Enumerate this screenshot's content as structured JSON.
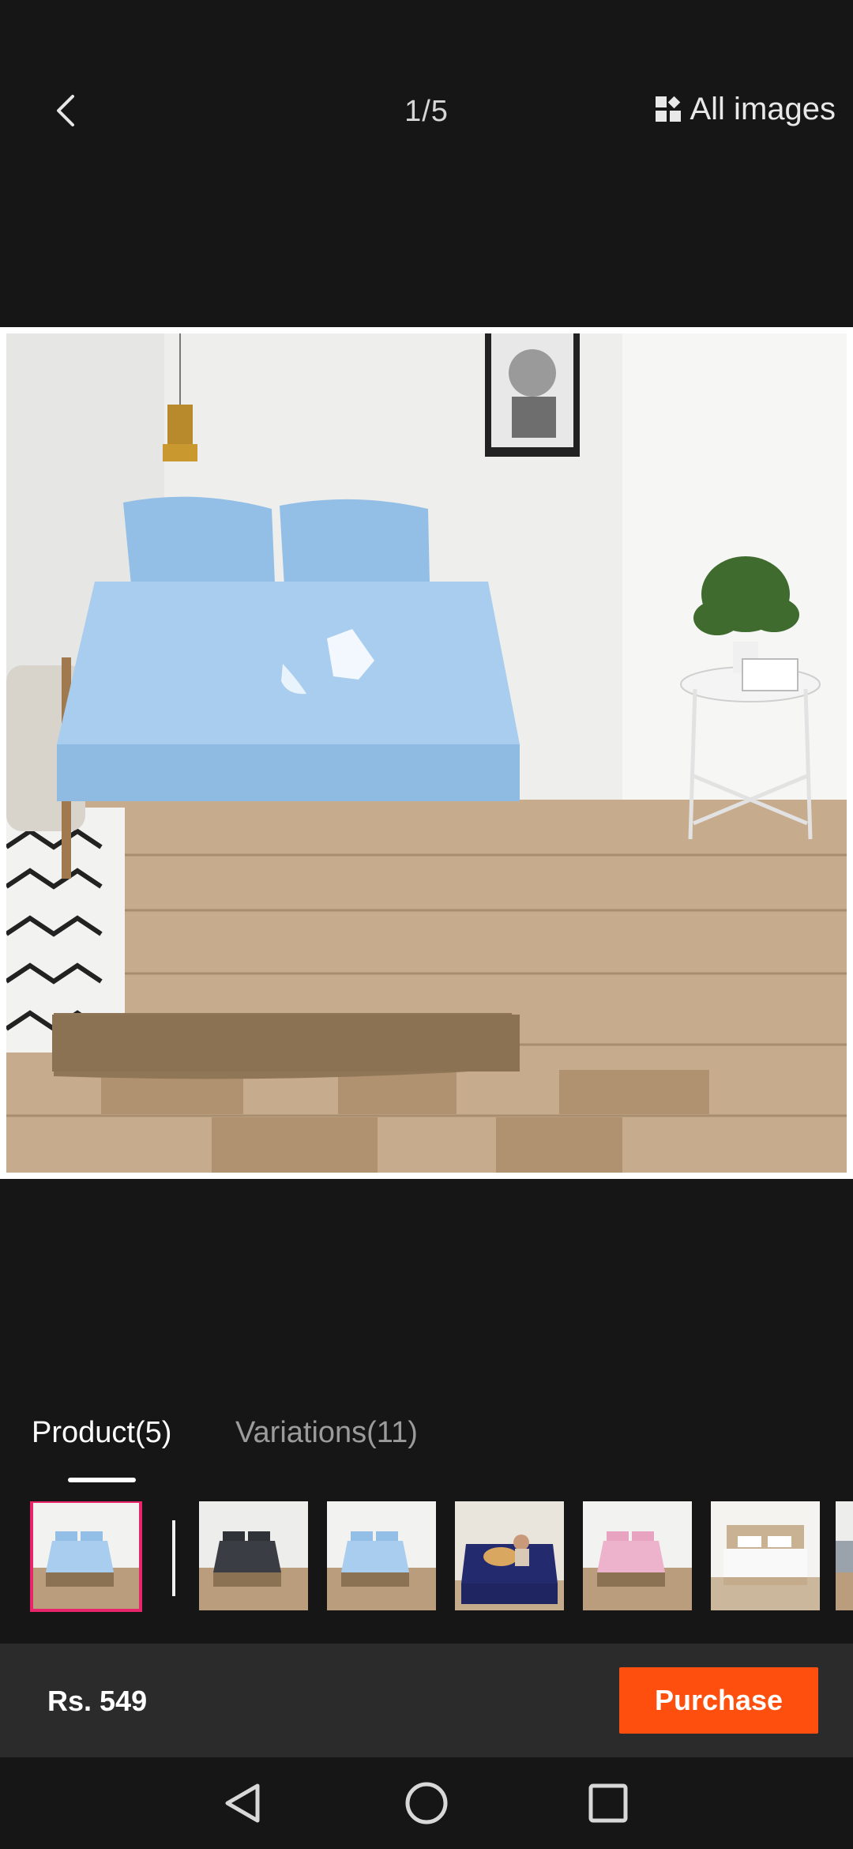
{
  "header": {
    "counter": "1/5",
    "all_images_label": "All images"
  },
  "tabs": [
    {
      "label": "Product(5)",
      "active": true
    },
    {
      "label": "Variations(11)",
      "active": false
    }
  ],
  "thumbnails": [
    {
      "name": "light-blue-sheet",
      "selected": true
    },
    {
      "name": "dark-grey-sheet",
      "selected": false
    },
    {
      "name": "light-blue-sheet-2",
      "selected": false
    },
    {
      "name": "navy-sheet-with-dog",
      "selected": false
    },
    {
      "name": "pink-sheet",
      "selected": false
    },
    {
      "name": "white-sheet",
      "selected": false
    },
    {
      "name": "grey-sheet-partial",
      "selected": false
    }
  ],
  "purchase": {
    "price": "Rs. 549",
    "button_label": "Purchase"
  },
  "colors": {
    "background": "#161616",
    "accent": "#fe4f0f",
    "selected_border": "#e8246b",
    "purchase_bar": "#2b2b2b"
  },
  "icons": {
    "back": "chevron-left-icon",
    "all_images": "grid-icon",
    "nav_back": "triangle-back-icon",
    "nav_home": "circle-home-icon",
    "nav_recents": "square-recents-icon"
  }
}
